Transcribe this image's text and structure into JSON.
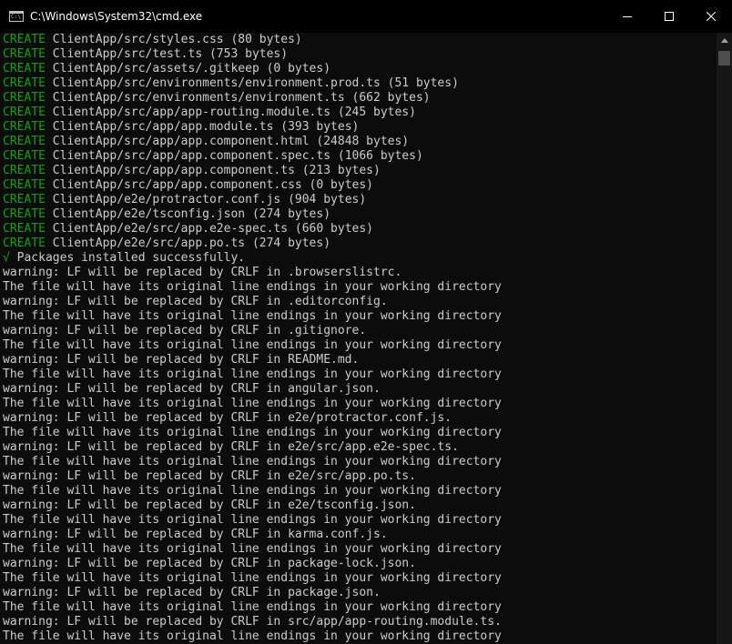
{
  "window": {
    "title": "C:\\Windows\\System32\\cmd.exe",
    "icon": "cmd-icon",
    "controls": [
      "minimize-icon",
      "maximize-icon",
      "close-icon"
    ]
  },
  "console": {
    "lines": [
      {
        "prefix": "CREATE",
        "text": " ClientApp/src/styles.css (80 bytes)"
      },
      {
        "prefix": "CREATE",
        "text": " ClientApp/src/test.ts (753 bytes)"
      },
      {
        "prefix": "CREATE",
        "text": " ClientApp/src/assets/.gitkeep (0 bytes)"
      },
      {
        "prefix": "CREATE",
        "text": " ClientApp/src/environments/environment.prod.ts (51 bytes)"
      },
      {
        "prefix": "CREATE",
        "text": " ClientApp/src/environments/environment.ts (662 bytes)"
      },
      {
        "prefix": "CREATE",
        "text": " ClientApp/src/app/app-routing.module.ts (245 bytes)"
      },
      {
        "prefix": "CREATE",
        "text": " ClientApp/src/app/app.module.ts (393 bytes)"
      },
      {
        "prefix": "CREATE",
        "text": " ClientApp/src/app/app.component.html (24848 bytes)"
      },
      {
        "prefix": "CREATE",
        "text": " ClientApp/src/app/app.component.spec.ts (1066 bytes)"
      },
      {
        "prefix": "CREATE",
        "text": " ClientApp/src/app/app.component.ts (213 bytes)"
      },
      {
        "prefix": "CREATE",
        "text": " ClientApp/src/app/app.component.css (0 bytes)"
      },
      {
        "prefix": "CREATE",
        "text": " ClientApp/e2e/protractor.conf.js (904 bytes)"
      },
      {
        "prefix": "CREATE",
        "text": " ClientApp/e2e/tsconfig.json (274 bytes)"
      },
      {
        "prefix": "CREATE",
        "text": " ClientApp/e2e/src/app.e2e-spec.ts (660 bytes)"
      },
      {
        "prefix": "CREATE",
        "text": " ClientApp/e2e/src/app.po.ts (274 bytes)"
      },
      {
        "prefix": "√",
        "text": " Packages installed successfully."
      },
      {
        "prefix": "",
        "text": "warning: LF will be replaced by CRLF in .browserslistrc."
      },
      {
        "prefix": "",
        "text": "The file will have its original line endings in your working directory"
      },
      {
        "prefix": "",
        "text": "warning: LF will be replaced by CRLF in .editorconfig."
      },
      {
        "prefix": "",
        "text": "The file will have its original line endings in your working directory"
      },
      {
        "prefix": "",
        "text": "warning: LF will be replaced by CRLF in .gitignore."
      },
      {
        "prefix": "",
        "text": "The file will have its original line endings in your working directory"
      },
      {
        "prefix": "",
        "text": "warning: LF will be replaced by CRLF in README.md."
      },
      {
        "prefix": "",
        "text": "The file will have its original line endings in your working directory"
      },
      {
        "prefix": "",
        "text": "warning: LF will be replaced by CRLF in angular.json."
      },
      {
        "prefix": "",
        "text": "The file will have its original line endings in your working directory"
      },
      {
        "prefix": "",
        "text": "warning: LF will be replaced by CRLF in e2e/protractor.conf.js."
      },
      {
        "prefix": "",
        "text": "The file will have its original line endings in your working directory"
      },
      {
        "prefix": "",
        "text": "warning: LF will be replaced by CRLF in e2e/src/app.e2e-spec.ts."
      },
      {
        "prefix": "",
        "text": "The file will have its original line endings in your working directory"
      },
      {
        "prefix": "",
        "text": "warning: LF will be replaced by CRLF in e2e/src/app.po.ts."
      },
      {
        "prefix": "",
        "text": "The file will have its original line endings in your working directory"
      },
      {
        "prefix": "",
        "text": "warning: LF will be replaced by CRLF in e2e/tsconfig.json."
      },
      {
        "prefix": "",
        "text": "The file will have its original line endings in your working directory"
      },
      {
        "prefix": "",
        "text": "warning: LF will be replaced by CRLF in karma.conf.js."
      },
      {
        "prefix": "",
        "text": "The file will have its original line endings in your working directory"
      },
      {
        "prefix": "",
        "text": "warning: LF will be replaced by CRLF in package-lock.json."
      },
      {
        "prefix": "",
        "text": "The file will have its original line endings in your working directory"
      },
      {
        "prefix": "",
        "text": "warning: LF will be replaced by CRLF in package.json."
      },
      {
        "prefix": "",
        "text": "The file will have its original line endings in your working directory"
      },
      {
        "prefix": "",
        "text": "warning: LF will be replaced by CRLF in src/app/app-routing.module.ts."
      },
      {
        "prefix": "",
        "text": "The file will have its original line endings in your working directory"
      }
    ]
  },
  "colors": {
    "background": "#0c0c0c",
    "text": "#cccccc",
    "create_green": "#13a10e",
    "titlebar": "#000000"
  }
}
